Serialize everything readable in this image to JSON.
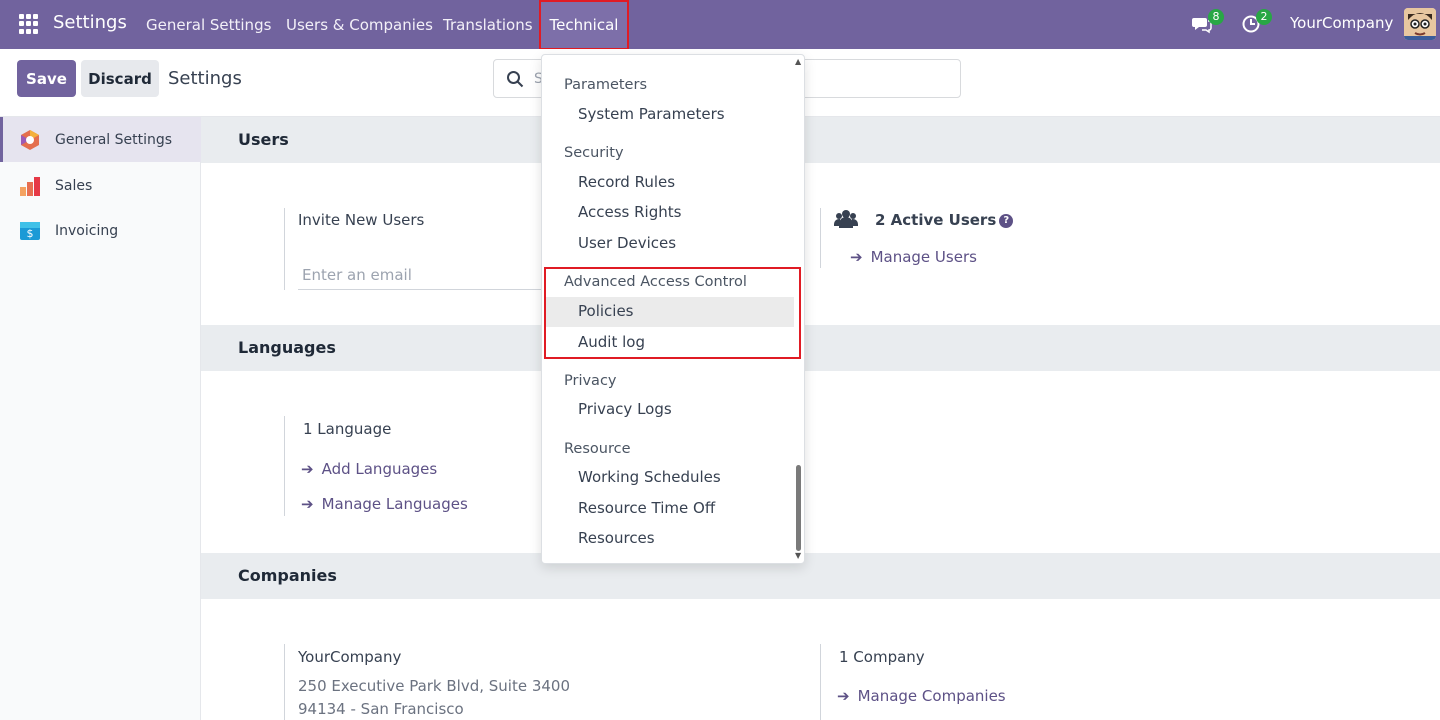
{
  "navbar": {
    "app_title": "Settings",
    "menus": [
      "General Settings",
      "Users & Companies",
      "Translations"
    ],
    "technical": "Technical",
    "messages_count": "8",
    "activities_count": "2",
    "company": "YourCompany"
  },
  "control_panel": {
    "save_label": "Save",
    "discard_label": "Discard",
    "title": "Settings",
    "search_placeholder": "S"
  },
  "sidebar": {
    "items": [
      {
        "label": "General Settings",
        "icon": "settings-app-icon"
      },
      {
        "label": "Sales",
        "icon": "sales-app-icon"
      },
      {
        "label": "Invoicing",
        "icon": "invoicing-app-icon"
      }
    ]
  },
  "main": {
    "users_section": "Users",
    "invite_label": "Invite New Users",
    "email_placeholder": "Enter an email",
    "active_users": "2 Active Users",
    "manage_users": "Manage Users",
    "languages_section": "Languages",
    "language_count": "1 Language",
    "add_languages": "Add Languages",
    "manage_languages": "Manage Languages",
    "companies_section": "Companies",
    "company_name": "YourCompany",
    "address_line1": "250 Executive Park Blvd, Suite 3400",
    "address_line2": "94134 - San Francisco",
    "company_count": "1 Company",
    "manage_companies": "Manage Companies"
  },
  "dropdown": {
    "groups": [
      {
        "header": "Parameters",
        "items": [
          "System Parameters"
        ]
      },
      {
        "header": "Security",
        "items": [
          "Record Rules",
          "Access Rights",
          "User Devices"
        ]
      },
      {
        "header": "Advanced Access Control",
        "items": [
          "Policies",
          "Audit log"
        ]
      },
      {
        "header": "Privacy",
        "items": [
          "Privacy Logs"
        ]
      },
      {
        "header": "Resource",
        "items": [
          "Working Schedules",
          "Resource Time Off",
          "Resources"
        ]
      }
    ]
  },
  "colors": {
    "brand": "#71639e",
    "highlight": "#e01b24",
    "badge": "#28a745",
    "link": "#5d5186"
  }
}
